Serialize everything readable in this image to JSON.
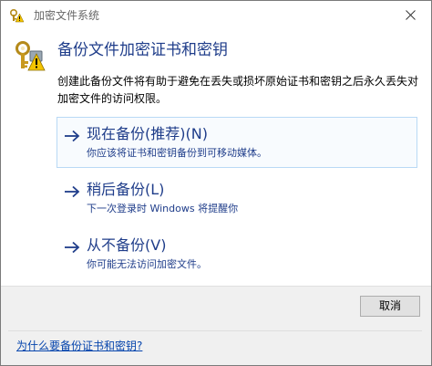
{
  "window": {
    "title": "加密文件系统",
    "close_label": "×"
  },
  "header": {
    "title": "备份文件加密证书和密钥",
    "description": "创建此备份文件将有助于避免在丢失或损坏原始证书和密钥之后永久丢失对加密文件的访问权限。"
  },
  "options": [
    {
      "title": "现在备份(推荐)(N)",
      "description": "你应该将证书和密钥备份到可移动媒体。"
    },
    {
      "title": "稍后备份(L)",
      "description": "下一次登录时 Windows 将提醒你"
    },
    {
      "title": "从不备份(V)",
      "description": "你可能无法访问加密文件。"
    }
  ],
  "footer": {
    "cancel_label": "取消",
    "help_link": "为什么要备份证书和密钥?"
  },
  "colors": {
    "accent_text": "#1f3d8a",
    "link": "#0645ad",
    "selected_border": "#b9d9f5"
  },
  "icons": {
    "title": "key-lock-warning-icon",
    "header": "key-lock-warning-icon",
    "option": "arrow-right-icon",
    "close": "close-icon"
  }
}
